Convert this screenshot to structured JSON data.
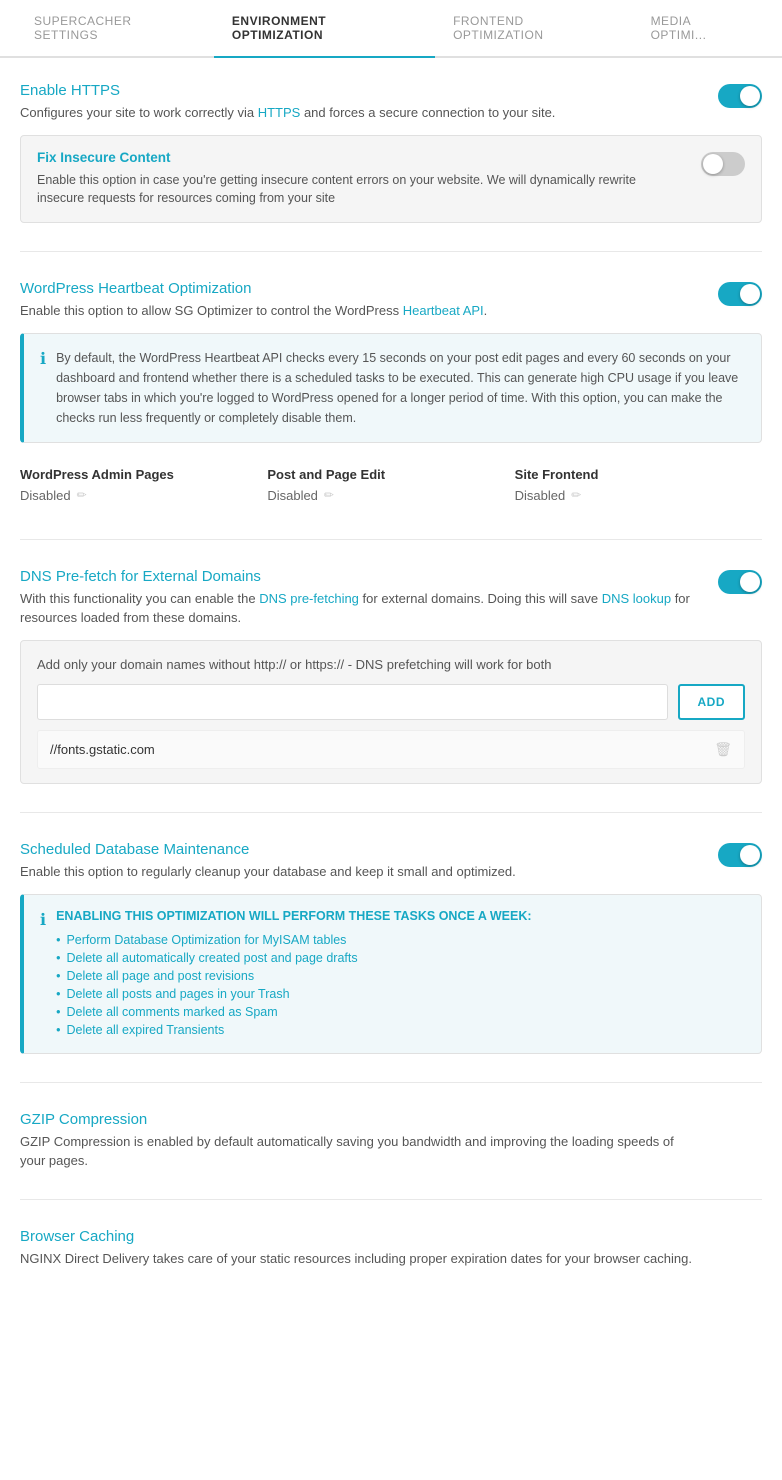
{
  "nav": {
    "tabs": [
      {
        "id": "supercacher",
        "label": "SUPERCACHER SETTINGS",
        "active": false
      },
      {
        "id": "environment",
        "label": "ENVIRONMENT OPTIMIZATION",
        "active": true
      },
      {
        "id": "frontend",
        "label": "FRONTEND OPTIMIZATION",
        "active": false
      },
      {
        "id": "media",
        "label": "MEDIA OPTIMI...",
        "active": false
      }
    ]
  },
  "sections": {
    "https": {
      "title": "Enable HTTPS",
      "desc": "Configures your site to work correctly via HTTPS and forces a secure connection to your site.",
      "toggle": "on",
      "subsection": {
        "title": "Fix Insecure Content",
        "desc": "Enable this option in case you're getting insecure content errors on your website. We will dynamically rewrite insecure requests for resources coming from your site",
        "toggle": "off"
      }
    },
    "heartbeat": {
      "title": "WordPress Heartbeat Optimization",
      "desc": "Enable this option to allow SG Optimizer to control the WordPress Heartbeat API.",
      "toggle": "on",
      "info": "By default, the WordPress Heartbeat API checks every 15 seconds on your post edit pages and every 60 seconds on your dashboard and frontend whether there is a scheduled tasks to be executed. This can generate high CPU usage if you leave browser tabs in which you're logged to WordPress opened for a longer period of time. With this option, you can make the checks run less frequently or completely disable them.",
      "columns": [
        {
          "label": "WordPress Admin Pages",
          "value": "Disabled"
        },
        {
          "label": "Post and Page Edit",
          "value": "Disabled"
        },
        {
          "label": "Site Frontend",
          "value": "Disabled"
        }
      ]
    },
    "dns": {
      "title": "DNS Pre-fetch for External Domains",
      "desc": "With this functionality you can enable the DNS pre-fetching for external domains. Doing this will save DNS lookup for resources loaded from these domains.",
      "toggle": "on",
      "hint": "Add only your domain names without http:// or https:// - DNS prefetching will work for both",
      "input_placeholder": "",
      "add_button": "ADD",
      "entry": "//fonts.gstatic.com"
    },
    "database": {
      "title": "Scheduled Database Maintenance",
      "desc": "Enable this option to regularly cleanup your database and keep it small and optimized.",
      "toggle": "on",
      "header": "ENABLING THIS OPTIMIZATION WILL PERFORM THESE TASKS ONCE A WEEK:",
      "tasks": [
        "Perform Database Optimization for MyISAM tables",
        "Delete all automatically created post and page drafts",
        "Delete all page and post revisions",
        "Delete all posts and pages in your Trash",
        "Delete all comments marked as Spam",
        "Delete all expired Transients"
      ]
    },
    "gzip": {
      "title": "GZIP Compression",
      "desc": "GZIP Compression is enabled by default automatically saving you bandwidth and improving the loading speeds of your pages."
    },
    "browser": {
      "title": "Browser Caching",
      "desc": "NGINX Direct Delivery takes care of your static resources including proper expiration dates for your browser caching."
    }
  }
}
